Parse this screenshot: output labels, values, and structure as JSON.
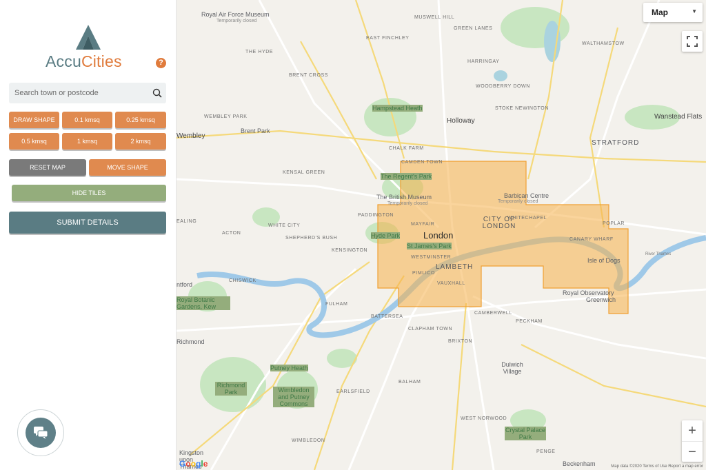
{
  "sidebar": {
    "logo_part1": "Accu",
    "logo_part2": "Cities",
    "help_label": "?",
    "search_placeholder": "Search town or postcode",
    "buttons": {
      "draw_shape": "DRAW SHAPE",
      "kmsq_01": "0.1 kmsq",
      "kmsq_025": "0.25 kmsq",
      "kmsq_05": "0.5 kmsq",
      "kmsq_1": "1 kmsq",
      "kmsq_2": "2 kmsq",
      "reset_map": "RESET MAP",
      "move_shape": "MOVE SHAPE",
      "hide_tiles": "HIDE TILES",
      "submit_details": "SUBMIT DETAILS"
    }
  },
  "map": {
    "map_type": "Map",
    "zoom_in": "+",
    "zoom_out": "−",
    "google": "Google",
    "attribution": "Map data ©2020   Terms of Use   Report a map error",
    "labels": {
      "raf_museum": "Royal Air Force Museum",
      "raf_closed": "Temporarily closed",
      "the_hyde": "THE HYDE",
      "brent_cross": "BRENT CROSS",
      "east_finchley": "EAST FINCHLEY",
      "muswell": "MUSWELL HILL",
      "green_lanes": "GREEN LANES",
      "walthamstow": "WALTHAMSTOW",
      "harringay": "HARRINGAY",
      "woodberry": "WOODBERRY DOWN",
      "hampstead": "Hampstead Heath",
      "holloway": "Holloway",
      "stoke_newington": "STOKE NEWINGTON",
      "wembley_park": "WEMBLEY PARK",
      "brent_park": "Brent Park",
      "wembley": "Wembley",
      "wanstead": "Wanstead Flats",
      "stratford": "STRATFORD",
      "chalk_farm": "CHALK FARM",
      "camden": "CAMDEN TOWN",
      "regents_park": "The Regent's Park",
      "kensal": "KENSAL GREEN",
      "british_museum": "The British Museum",
      "bm_closed": "Temporarily closed",
      "barbican": "Barbican Centre",
      "barbican_closed": "Temporarily closed",
      "paddington": "PADDINGTON",
      "white_city": "WHITE CITY",
      "acton": "ACTON",
      "shepherds": "SHEPHERD'S BUSH",
      "mayfair": "MAYFAIR",
      "city_of_london": "CITY OF LONDON",
      "whitechapel": "WHITECHAPEL",
      "poplar": "POPLAR",
      "hyde_park": "Hyde Park",
      "london": "London",
      "st_james": "St James's Park",
      "canary": "CANARY WHARF",
      "kensington": "KENSINGTON",
      "westminster": "WESTMINSTER",
      "lambeth": "LAMBETH",
      "isle_of_dogs": "Isle of Dogs",
      "river_thames": "River Thames",
      "chiswick": "CHISWICK",
      "pimlico": "PIMLICO",
      "vauxhall": "VAUXHALL",
      "royal_obs": "Royal Observatory",
      "greenwich": "Greenwich",
      "kew": "Royal Botanic Gardens, Kew",
      "fulham": "FULHAM",
      "battersea": "BATTERSEA",
      "camberwell": "CAMBERWELL",
      "peckham": "PECKHAM",
      "clapham": "CLAPHAM TOWN",
      "brixton": "BRIXTON",
      "richmond": "Richmond",
      "putney": "Putney Heath",
      "dulwich": "Dulwich Village",
      "balham": "BALHAM",
      "earlsfield": "EARLSFIELD",
      "richmond_park": "Richmond Park",
      "wimbledon_putney": "Wimbledon and Putney Commons",
      "west_norwood": "WEST NORWOOD",
      "crystal_palace": "Crystal Palace Park",
      "wimbledon": "WIMBLEDON",
      "kingston": "Kingston upon Thames",
      "penge": "PENGE",
      "beckenham": "Beckenham",
      "ealing": "EALING",
      "brentford": "ntford"
    }
  },
  "chat_label": "chat"
}
